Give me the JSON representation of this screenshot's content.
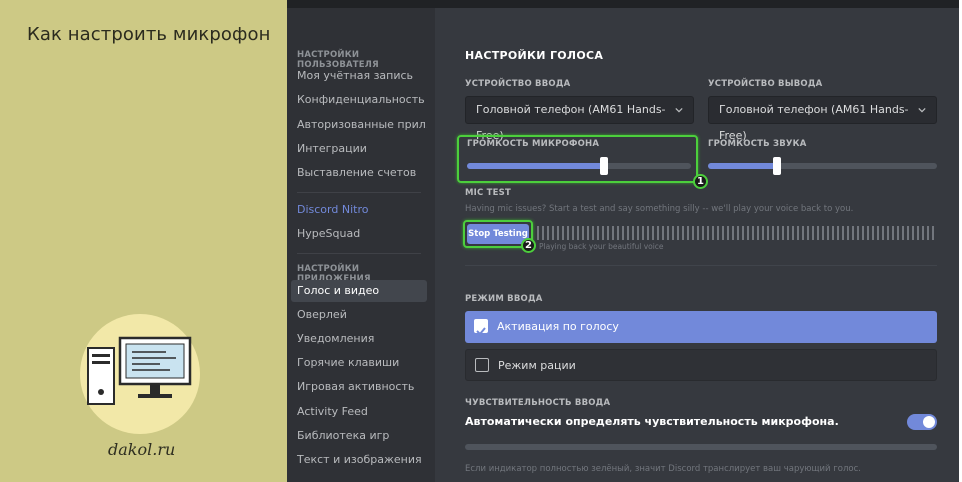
{
  "promo": {
    "title": "Как настроить микрофон",
    "site": "dakol.ru"
  },
  "sidebar": {
    "user_header": "НАСТРОЙКИ ПОЛЬЗОВАТЕЛЯ",
    "user_items": [
      "Моя учётная запись",
      "Конфиденциальность",
      "Авторизованные прил...",
      "Интеграции",
      "Выставление счетов"
    ],
    "nitro": "Discord Nitro",
    "hypesquad": "HypeSquad",
    "app_header": "НАСТРОЙКИ ПРИЛОЖЕНИЯ",
    "app_items": [
      "Голос и видео",
      "Оверлей",
      "Уведомления",
      "Горячие клавиши",
      "Игровая активность",
      "Activity Feed",
      "Библиотека игр",
      "Текст и изображения"
    ],
    "selected": "Голос и видео"
  },
  "voice": {
    "title": "НАСТРОЙКИ ГОЛОСА",
    "input_device_label": "УСТРОЙСТВО ВВОДА",
    "input_device_value": "Головной телефон (AM61 Hands-Free)",
    "output_device_label": "УСТРОЙСТВО ВЫВОДА",
    "output_device_value": "Головной телефон (AM61 Hands-Free)",
    "mic_volume_label": "ГРОМКОСТЬ МИКРОФОНА",
    "mic_volume_percent": 61,
    "sound_volume_label": "ГРОМКОСТЬ ЗВУКА",
    "sound_volume_percent": 30,
    "badge_1": "1",
    "badge_2": "2",
    "mic_test_label": "MIC TEST",
    "mic_test_help": "Having mic issues? Start a test and say something silly -- we'll play your voice back to you.",
    "stop_testing": "Stop Testing",
    "playback_text": "Playing back your beautiful voice",
    "input_mode_label": "РЕЖИМ ВВОДА",
    "voice_activity": "Активация по голосу",
    "push_to_talk": "Режим рации",
    "sensitivity_label": "ЧУВСТВИТЕЛЬНОСТЬ ВВОДА",
    "auto_sensitivity": "Автоматически определять чувствительность микрофона.",
    "auto_sensitivity_on": true,
    "sensitivity_help": "Если индикатор полностью зелёный, значит Discord транслирует ваш чарующий голос."
  },
  "colors": {
    "accent": "#7289da",
    "highlight": "#4ccf3c",
    "promo_bg": "#cdc985"
  },
  "icons": [
    "computer-icon",
    "chevron-down-icon",
    "checkmark-icon"
  ]
}
